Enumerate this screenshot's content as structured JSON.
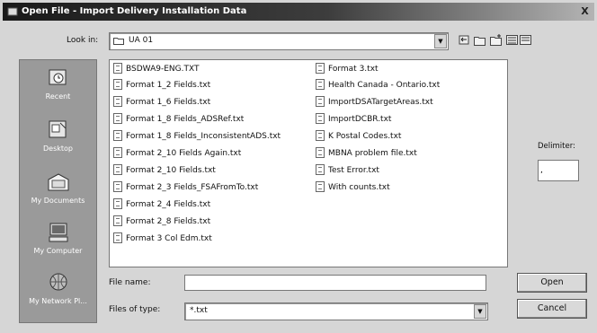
{
  "window": {
    "title": "Open File - Import Delivery Installation Data",
    "close_label": "X"
  },
  "lookin": {
    "label": "Look in:",
    "value": "UA 01"
  },
  "toolbar": {
    "icons": [
      "back-icon",
      "up-folder-icon",
      "new-folder-icon",
      "view-menu-icon"
    ]
  },
  "places": [
    {
      "label": "Recent",
      "icon": "recent-icon"
    },
    {
      "label": "Desktop",
      "icon": "desktop-icon"
    },
    {
      "label": "My Documents",
      "icon": "my-documents-icon"
    },
    {
      "label": "My Computer",
      "icon": "my-computer-icon"
    },
    {
      "label": "My Network Pl...",
      "icon": "network-icon"
    }
  ],
  "files": [
    "BSDWA9-ENG.TXT",
    "Format 1_2 Fields.txt",
    "Format 1_6 Fields.txt",
    "Format 1_8 Fields_ADSRef.txt",
    "Format 1_8 Fields_InconsistentADS.txt",
    "Format 2_10 Fields Again.txt",
    "Format 2_10 Fields.txt",
    "Format 2_3 Fields_FSAFromTo.txt",
    "Format 2_4 Fields.txt",
    "Format 2_8 Fields.txt",
    "Format 3 Col Edm.txt",
    "Format 3.txt",
    "Health Canada - Ontario.txt",
    "ImportDSATargetAreas.txt",
    "ImportDCBR.txt",
    "K Postal Codes.txt",
    "MBNA problem file.txt",
    "Test Error.txt",
    "With counts.txt"
  ],
  "delimiter": {
    "label": "Delimiter:",
    "value": ","
  },
  "filename": {
    "label": "File name:",
    "value": ""
  },
  "filetype": {
    "label": "Files of type:",
    "value": "*.txt"
  },
  "buttons": {
    "open": "Open",
    "cancel": "Cancel"
  }
}
